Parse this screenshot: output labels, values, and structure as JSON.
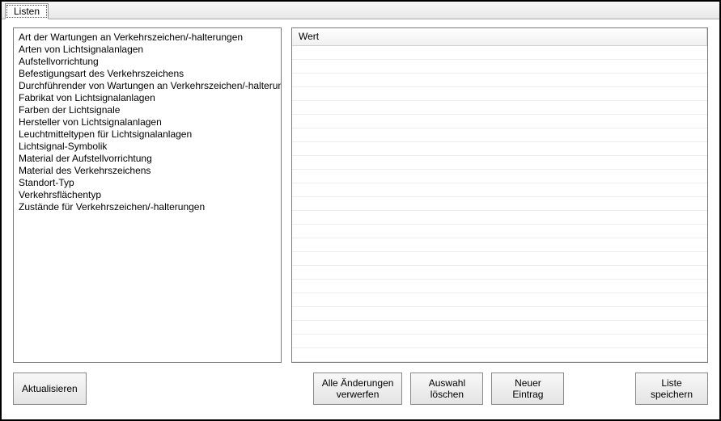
{
  "tab": {
    "label": "Listen"
  },
  "left_list": {
    "items": [
      "Art der Wartungen an Verkehrszeichen/-halterungen",
      "Arten von Lichtsignalanlagen",
      "Aufstellvorrichtung",
      "Befestigungsart des Verkehrszeichens",
      "Durchführender von Wartungen an Verkehrszeichen/-halterungen",
      "Fabrikat von Lichtsignalanlagen",
      "Farben der Lichtsignale",
      "Hersteller von Lichtsignalanlagen",
      "Leuchtmitteltypen für Lichtsignalanlagen",
      "Lichtsignal-Symbolik",
      "Material der Aufstellvorrichtung",
      "Material des Verkehrszeichens",
      "Standort-Typ",
      "Verkehrsflächentyp",
      "Zustände für Verkehrszeichen/-halterungen"
    ]
  },
  "right_grid": {
    "columns": [
      "Wert"
    ],
    "rows": []
  },
  "buttons": {
    "refresh": "Aktualisieren",
    "discard": "Alle Änderungen\nverwerfen",
    "delete": "Auswahl\nlöschen",
    "new": "Neuer\nEintrag",
    "save": "Liste\nspeichern"
  }
}
